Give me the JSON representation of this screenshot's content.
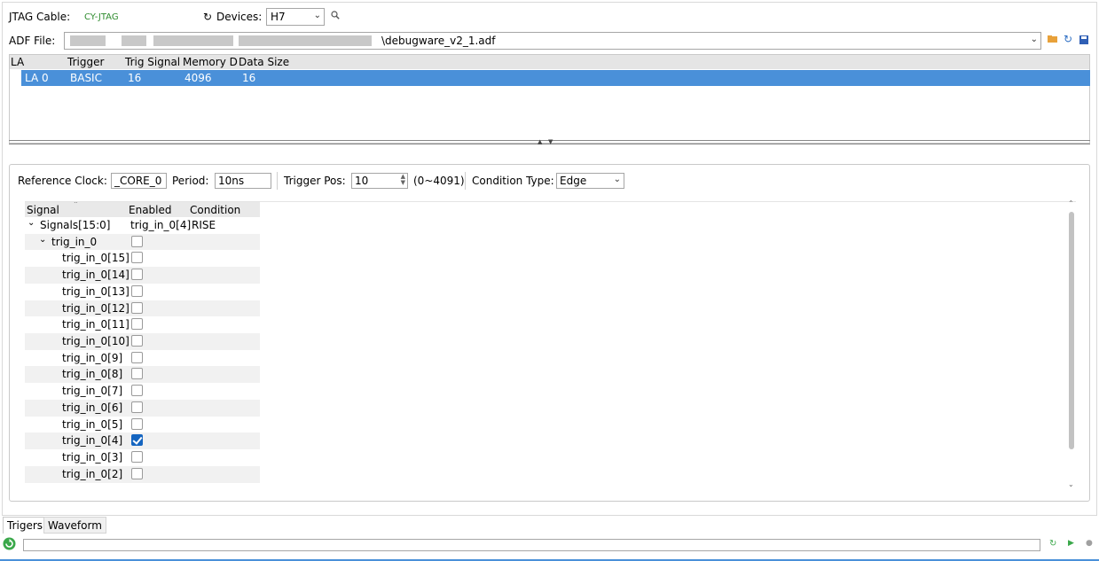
{
  "toolbar": {
    "jtag_label": "JTAG Cable:",
    "jtag_value": "CY-JTAG",
    "devices_label": "Devices:",
    "device_value": "H7",
    "adf_label": "ADF File:",
    "adf_value": "\\debugware_v2_1.adf"
  },
  "la_table": {
    "columns": [
      "LA",
      "Trigger",
      "Trig Signal",
      "Memory Dep",
      "Data Size"
    ],
    "rows": [
      {
        "la": "LA 0",
        "trigger": "BASIC",
        "trig_signal": "16",
        "memory": "4096",
        "data_size": "16"
      }
    ]
  },
  "trigger_settings": {
    "ref_clock_label": "Reference Clock:",
    "ref_clock_value": "_CORE_0",
    "period_label": "Period:",
    "period_value": "10ns",
    "trigger_pos_label": "Trigger Pos:",
    "trigger_pos_value": "10",
    "trigger_pos_range": "(0~4091)",
    "condition_type_label": "Condition Type:",
    "condition_type_value": "Edge"
  },
  "signal_table": {
    "columns": [
      "Signal",
      "Enabled",
      "Condition"
    ],
    "group": {
      "name": "Signals[15:0]",
      "enabled": "trig_in_0[4]",
      "condition": "RISE"
    },
    "subgroup": "trig_in_0",
    "signals": [
      {
        "name": "trig_in_0[15]",
        "enabled": false
      },
      {
        "name": "trig_in_0[14]",
        "enabled": false
      },
      {
        "name": "trig_in_0[13]",
        "enabled": false
      },
      {
        "name": "trig_in_0[12]",
        "enabled": false
      },
      {
        "name": "trig_in_0[11]",
        "enabled": false
      },
      {
        "name": "trig_in_0[10]",
        "enabled": false
      },
      {
        "name": "trig_in_0[9]",
        "enabled": false
      },
      {
        "name": "trig_in_0[8]",
        "enabled": false
      },
      {
        "name": "trig_in_0[7]",
        "enabled": false
      },
      {
        "name": "trig_in_0[6]",
        "enabled": false
      },
      {
        "name": "trig_in_0[5]",
        "enabled": false
      },
      {
        "name": "trig_in_0[4]",
        "enabled": true
      },
      {
        "name": "trig_in_0[3]",
        "enabled": false
      },
      {
        "name": "trig_in_0[2]",
        "enabled": false
      }
    ]
  },
  "tabs": [
    "Trigers",
    "Waveform"
  ],
  "colors": {
    "accent": "#4a90d9",
    "check": "#1565c0",
    "cable": "#2e8b2e"
  },
  "icons": [
    "refresh-devices-icon",
    "search-icon",
    "open-folder-icon",
    "reload-icon",
    "save-icon",
    "run-icon",
    "stop-icon"
  ]
}
